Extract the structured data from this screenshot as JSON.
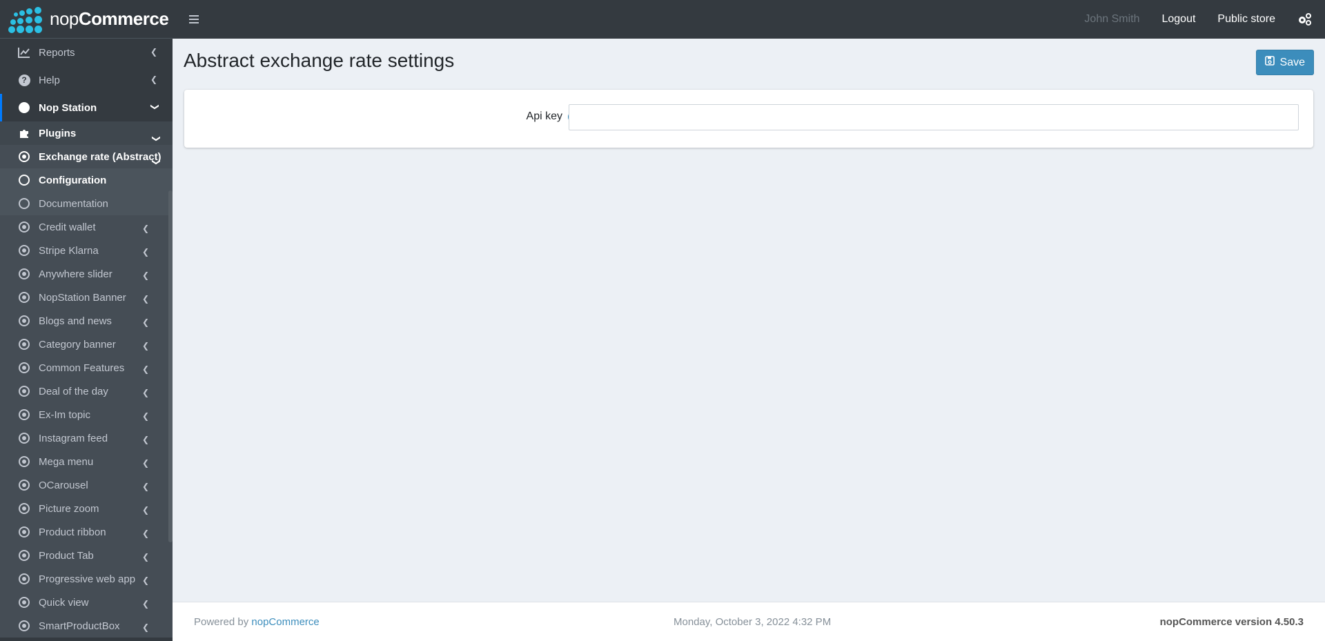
{
  "header": {
    "brand_light": "nop",
    "brand_bold": "Commerce",
    "user_name": "John Smith",
    "logout": "Logout",
    "public_store": "Public store"
  },
  "sidebar": {
    "top_items": [
      {
        "label": "Reports",
        "icon": "chart-line-icon"
      },
      {
        "label": "Help",
        "icon": "question-circle-icon"
      },
      {
        "label": "Nop Station",
        "icon": "nopstation-icon"
      }
    ],
    "plugins": {
      "label": "Plugins"
    },
    "exchange": {
      "label": "Exchange rate (Abstract)"
    },
    "exchange_children": [
      {
        "label": "Configuration"
      },
      {
        "label": "Documentation"
      }
    ],
    "plugin_items": [
      {
        "label": "Credit wallet"
      },
      {
        "label": "Stripe Klarna"
      },
      {
        "label": "Anywhere slider"
      },
      {
        "label": "NopStation Banner"
      },
      {
        "label": "Blogs and news"
      },
      {
        "label": "Category banner"
      },
      {
        "label": "Common Features"
      },
      {
        "label": "Deal of the day"
      },
      {
        "label": "Ex-Im topic"
      },
      {
        "label": "Instagram feed"
      },
      {
        "label": "Mega menu"
      },
      {
        "label": "OCarousel"
      },
      {
        "label": "Picture zoom"
      },
      {
        "label": "Product ribbon"
      },
      {
        "label": "Product Tab"
      },
      {
        "label": "Progressive web app"
      },
      {
        "label": "Quick view"
      },
      {
        "label": "SmartProductBox"
      }
    ]
  },
  "main": {
    "title": "Abstract exchange rate settings",
    "save_label": "Save",
    "api_key_label": "Api key",
    "api_key_value": "",
    "help_glyph": "?"
  },
  "footer": {
    "powered_prefix": "Powered by ",
    "powered_link": "nopCommerce",
    "datetime": "Monday, October 3, 2022 4:32 PM",
    "version": "nopCommerce version 4.50.3"
  },
  "colors": {
    "accent": "#3c8dbc",
    "sidebar_bg": "#343a40",
    "active_indicator": "#007bff",
    "logo_dots": "#2bc0e4"
  }
}
